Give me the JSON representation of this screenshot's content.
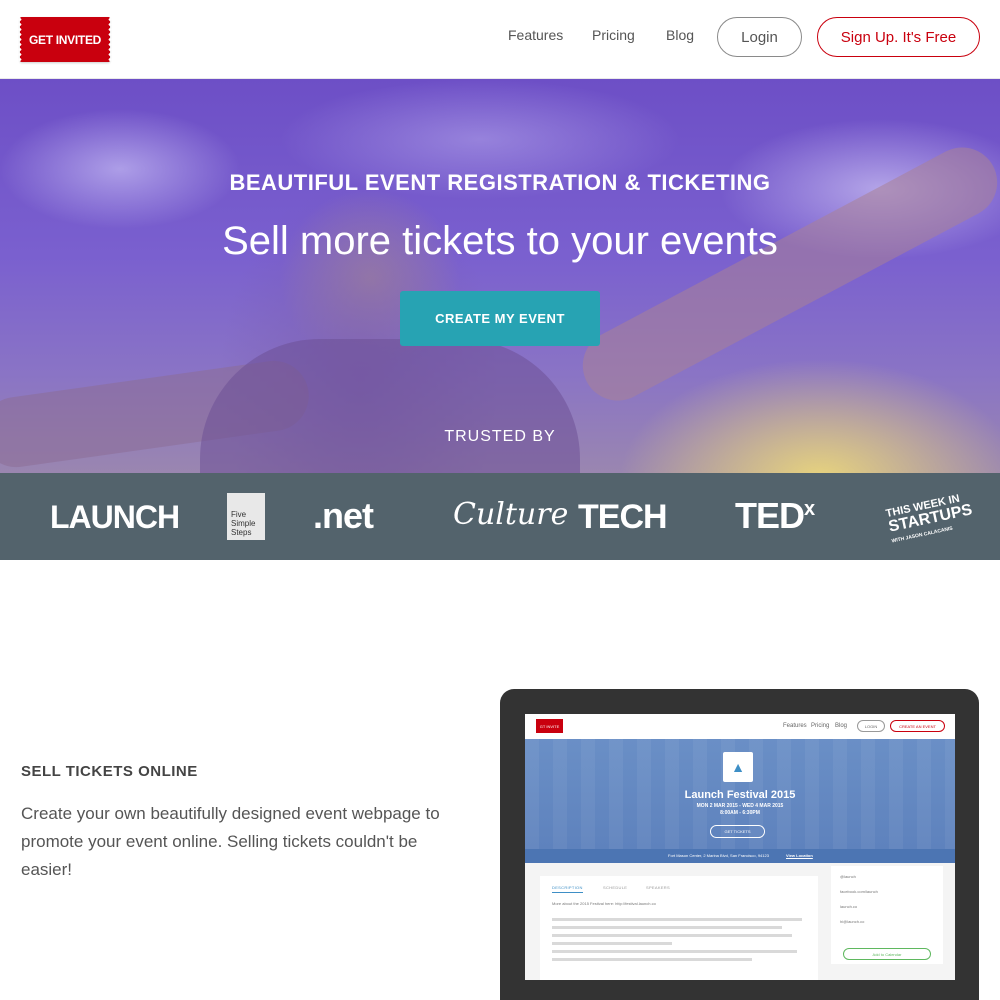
{
  "header": {
    "logo_text": "GET INVITED",
    "nav": {
      "features": "Features",
      "pricing": "Pricing",
      "blog": "Blog"
    },
    "login_label": "Login",
    "signup_label": "Sign Up. It's Free"
  },
  "hero": {
    "subtitle": "BEAUTIFUL EVENT REGISTRATION & TICKETING",
    "title": "Sell more tickets to your events",
    "cta_label": "CREATE MY EVENT",
    "trusted_label": "TRUSTED BY"
  },
  "clients": {
    "launch": "LAUNCH",
    "fss_line1": "Five",
    "fss_line2": "Simple",
    "fss_line3": "Steps",
    "net": ".net",
    "culture": "Culture",
    "tech": "TECH",
    "tedx_main": "TED",
    "tedx_sup": "x",
    "twis_line1": "THIS WEEK IN",
    "twis_line2": "STARTUPS",
    "twis_line3": "WITH JASON CALACANIS"
  },
  "section": {
    "heading": "SELL TICKETS ONLINE",
    "text": "Create your own beautifully designed event webpage to promote your event online. Selling tickets couldn't be easier!"
  },
  "mockup": {
    "logo_text": "GT INVITE",
    "nav": {
      "features": "Features",
      "pricing": "Pricing",
      "blog": "Blog"
    },
    "login_label": "LOGIN",
    "create_label": "CREATE AN EVENT",
    "event_title": "Launch Festival 2015",
    "event_date": "MON 2 MAR 2015 - WED 4 MAR 2015",
    "event_time": "8:00AM - 6:30PM",
    "tickets_label": "GET TICKETS",
    "address": "Fort Mason Center, 2 Marina Blvd, San Francisco, 94123",
    "view_location": "View Location",
    "tabs": {
      "description": "DESCRIPTION",
      "schedule": "SCHEDULE",
      "speakers": "SPEAKERS"
    },
    "description_intro": "More about the 2015 Festival here: http://festival.launch.co",
    "sidebar": {
      "twitter": "@launch",
      "facebook": "facebook.com/launch",
      "website": "launch.co",
      "email": "hi@launch.co",
      "calendar_label": "Add to Calendar"
    }
  },
  "colors": {
    "brand_red": "#c9000e",
    "cta_teal": "#27a3b3",
    "logo_strip": "#53636c",
    "device_frame": "#333333"
  }
}
